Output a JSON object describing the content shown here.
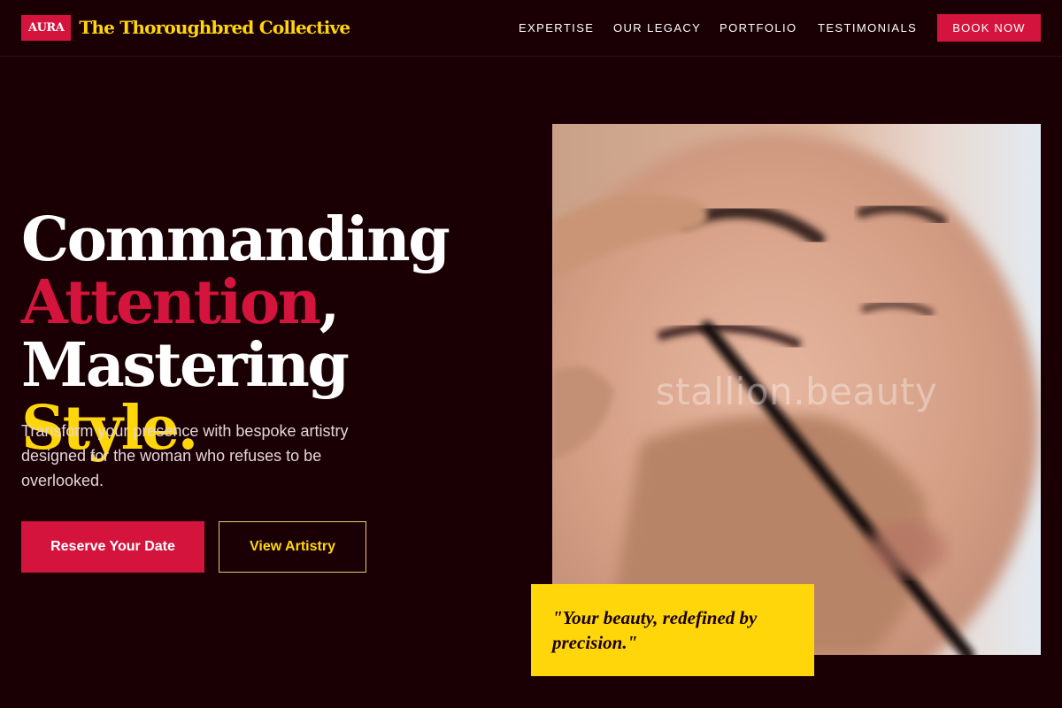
{
  "header": {
    "badge": "AURA",
    "brand_name": "The Thoroughbred Collective",
    "nav": [
      "EXPERTISE",
      "OUR LEGACY",
      "PORTFOLIO",
      "TESTIMONIALS"
    ],
    "cta": "BOOK NOW"
  },
  "hero": {
    "headline": {
      "line1": "Commanding",
      "line2_accent": "Attention",
      "line2_rest": ",",
      "line3_start": "Mastering ",
      "line3_accent": "Style."
    },
    "subtext": "Transform your presence with bespoke artistry designed for the woman who refuses to be overlooked.",
    "primary_button": "Reserve Your Date",
    "secondary_button": "View Artistry",
    "image_watermark": "stallion.beauty",
    "quote": "\"Your beauty, redefined by precision.\""
  },
  "colors": {
    "background": "#1a0005",
    "accent_red": "#d4143c",
    "accent_gold": "#ffd60a"
  }
}
